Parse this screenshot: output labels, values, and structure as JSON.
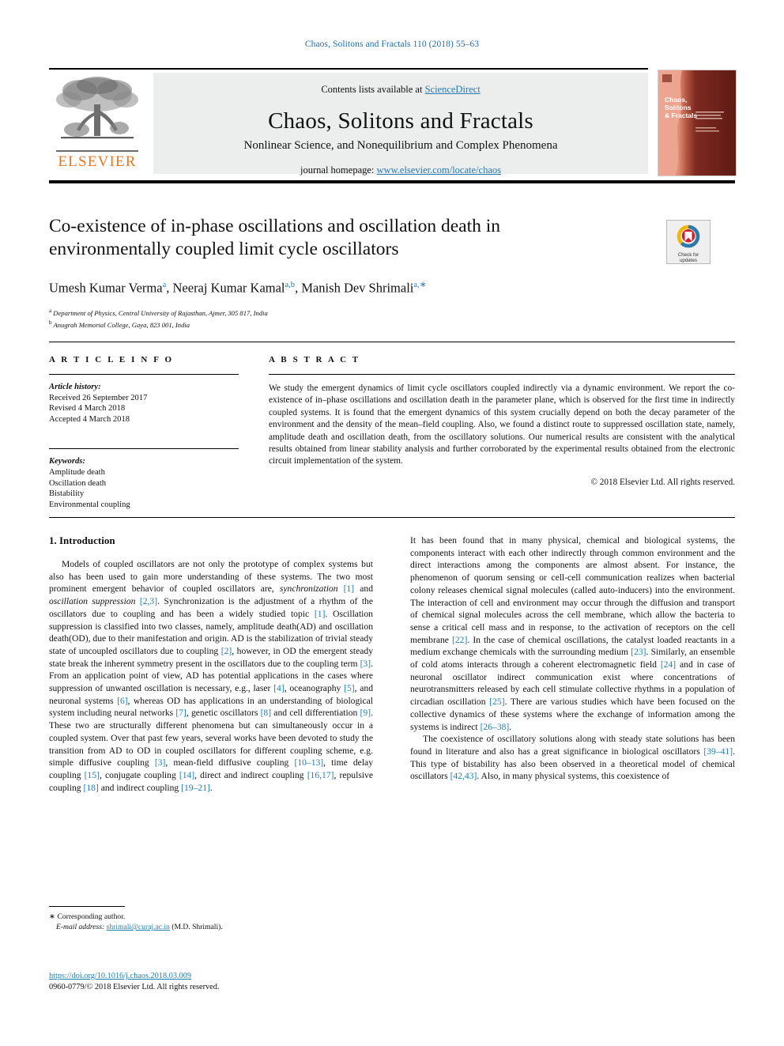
{
  "running_head": "Chaos, Solitons and Fractals 110 (2018) 55–63",
  "masthead": {
    "contents_prefix": "Contents lists available at ",
    "sciencedirect": "ScienceDirect",
    "journal_title": "Chaos, Solitons and Fractals",
    "journal_subtitle": "Nonlinear Science, and Nonequilibrium and Complex Phenomena",
    "homepage_prefix": "journal homepage: ",
    "homepage_url": "www.elsevier.com/locate/chaos",
    "publisher": "ELSEVIER",
    "cover_title_line1": "Chaos,",
    "cover_title_line2": "Solitons",
    "cover_title_line3": "& Fractals"
  },
  "article": {
    "title": "Co-existence of in-phase oscillations and oscillation death in environmentally coupled limit cycle oscillators",
    "authors_html": "Umesh Kumar Verma<sup>a</sup>, Neeraj Kumar Kamal<sup>a,b</sup>, Manish Dev Shrimali<sup>a,</sup><sup>∗</sup>",
    "affiliation_a": "Department of Physics, Central University of Rajasthan, Ajmer, 305 817, India",
    "affiliation_b": "Anugrah Memorial College, Gaya, 823 001, India",
    "crossmark_line1": "Check for",
    "crossmark_line2": "updates"
  },
  "info": {
    "heading": "A R T I C L E   I N F O",
    "history_label": "Article history:",
    "history": [
      "Received 26 September 2017",
      "Revised 4 March 2018",
      "Accepted 4 March 2018"
    ],
    "keywords_label": "Keywords:",
    "keywords": [
      "Amplitude death",
      "Oscillation death",
      "Bistability",
      "Environmental coupling"
    ]
  },
  "abstract": {
    "heading": "A B S T R A C T",
    "text": "We study the emergent dynamics of limit cycle oscillators coupled indirectly via a dynamic environment. We report the co-existence of in–phase oscillations and oscillation death in the parameter plane, which is observed for the first time in indirectly coupled systems. It is found that the emergent dynamics of this system crucially depend on both the decay parameter of the environment and the density of the mean–field coupling. Also, we found a distinct route to suppressed oscillation state, namely, amplitude death and oscillation death, from the oscillatory solutions. Our numerical results are consistent with the analytical results obtained from linear stability analysis and further corroborated by the experimental results obtained from the electronic circuit implementation of the system.",
    "copyright": "© 2018 Elsevier Ltd. All rights reserved."
  },
  "body": {
    "section_title": "1. Introduction",
    "left_paragraph_1_html": "Models of coupled oscillators are not only the prototype of complex systems but also has been used to gain more understanding of these systems. The two most prominent emergent behavior of coupled oscillators are, <i>synchronization</i> <span class=\"ref\">[1]</span> and <i>oscillation suppression</i> <span class=\"ref\">[2,3]</span>. Synchronization is the adjustment of a rhythm of the oscillators due to coupling and has been a widely studied topic <span class=\"ref\">[1]</span>. Oscillation suppression is classified into two classes, namely, amplitude death(AD) and oscillation death(OD), due to their manifestation and origin. AD is the stabilization of trivial steady state of uncoupled oscillators due to coupling <span class=\"ref\">[2]</span>, however, in OD the emergent steady state break the inherent symmetry present in the oscillators due to the coupling term <span class=\"ref\">[3]</span>. From an application point of view, AD has potential applications in the cases where suppression of unwanted oscillation is necessary, e.g., laser <span class=\"ref\">[4]</span>, oceanography <span class=\"ref\">[5]</span>, and neuronal systems <span class=\"ref\">[6]</span>, whereas OD has applications in an understanding of biological system including neural networks <span class=\"ref\">[7]</span>, genetic oscillators <span class=\"ref\">[8]</span> and cell differentiation <span class=\"ref\">[9]</span>. These two are structurally different phenomena but can simultaneously occur in a coupled system. Over that past few years, several works have been devoted to study the transition from AD to OD in coupled oscillators for different coupling scheme, e.g. simple diffusive coupling <span class=\"ref\">[3]</span>, mean-field diffusive coupling <span class=\"ref\">[10–13]</span>, time delay coupling <span class=\"ref\">[15]</span>, conjugate coupling <span class=\"ref\">[14]</span>, direct and indirect coupling <span class=\"ref\">[16,17]</span>, repulsive coupling <span class=\"ref\">[18]</span> and indirect coupling <span class=\"ref\">[19–21]</span>.",
    "right_paragraph_1_html": "It has been found that in many physical, chemical and biological systems, the components interact with each other indirectly through common environment and the direct interactions among the components are almost absent. For instance, the phenomenon of quorum sensing or cell-cell communication realizes when bacterial colony releases chemical signal molecules (called auto-inducers) into the environment. The interaction of cell and environment may occur through the diffusion and transport of chemical signal molecules across the cell membrane, which allow the bacteria to sense a critical cell mass and in response, to the activation of receptors on the cell membrane <span class=\"ref\">[22]</span>. In the case of chemical oscillations, the catalyst loaded reactants in a medium exchange chemicals with the surrounding medium <span class=\"ref\">[23]</span>. Similarly, an ensemble of cold atoms interacts through a coherent electromagnetic field <span class=\"ref\">[24]</span> and in case of neuronal oscillator indirect communication exist where concentrations of neurotransmitters released by each cell stimulate collective rhythms in a population of circadian oscillation <span class=\"ref\">[25]</span>. There are various studies which have been focused on the collective dynamics of these systems where the exchange of information among the systems is indirect <span class=\"ref\">[26–38]</span>.",
    "right_paragraph_2_html": "The coexistence of oscillatory solutions along with steady state solutions has been found in literature and also has a great significance in biological oscillators <span class=\"ref\">[39–41]</span>. This type of bistability has also been observed in a theoretical model of chemical oscillators <span class=\"ref\">[42,43]</span>. Also, in many physical systems, this coexistence of"
  },
  "footnote": {
    "star": "∗",
    "corresponding": "Corresponding author.",
    "email_label": "E-mail address:",
    "email": "shrimali@curaj.ac.in",
    "email_suffix": "(M.D. Shrimali)."
  },
  "footer": {
    "doi": "https://doi.org/10.1016/j.chaos.2018.03.009",
    "issn_line": "0960-0779/© 2018 Elsevier Ltd. All rights reserved."
  },
  "colors": {
    "link_blue": "#1f7fae",
    "elsevier_orange": "#E87722",
    "band_grey": "#eceded"
  }
}
